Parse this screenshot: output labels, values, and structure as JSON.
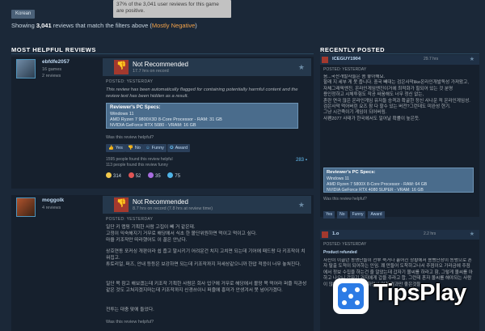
{
  "tooltip": "37% of the 3,041 user reviews for this game are positive.",
  "language_filter": "Korean",
  "summary": {
    "prefix": "Showing",
    "count": "3,041",
    "middle": "reviews that match the filters above (",
    "rating": "Mostly Negative",
    "suffix": ")"
  },
  "sections": {
    "helpful": "MOST HELPFUL REVIEWS",
    "recent": "RECENTLY POSTED"
  },
  "review1": {
    "user": "ebfdfe2057",
    "games": "16 games",
    "reviews": "2 reviews",
    "verdict": "Not Recommended",
    "hours": "17.7 hrs on record",
    "posted": "POSTED: YESTERDAY",
    "body": "This review has been automatically flagged for containing potentially harmful content and the review text has been hidden as a result.",
    "specs_title": "Reviewer's PC Specs:",
    "specs": [
      "Windows 11",
      "AMD Ryzen 7 9800X3D 8-Core Processor - RAM: 31 GB",
      "NVIDIA GeForce RTX 5080 - VRAM: 16 GB"
    ],
    "helpful_q": "Was this review helpful?",
    "btn_yes": "Yes",
    "btn_no": "No",
    "btn_funny": "Funny",
    "btn_award": "Award",
    "found_helpful": "1595 people found this review helpful",
    "found_funny": "113 people found this review funny",
    "comments": "283",
    "awards": [
      "314",
      "52",
      "35",
      "75"
    ]
  },
  "review2": {
    "user": "moggolk",
    "reviews": "4 reviews",
    "verdict": "Not Recommended",
    "hours": "8.7 hrs on record (7.8 hrs at review time)",
    "posted": "POSTED: YESTERDAY",
    "paragraphs": [
      "일단 키 맵핑 기획한 사람 고집이 빼 거 같은데.",
      "고정이 익숙해지기 거무로 해당에서 식초 한 볼단위원하면 먹이고 먹이고 싶다.",
      "마을 키조작만 따라했어도 이 꼴은 안났다.",
      "상호연동 포커싱 개판이라 쉽 줍고 말시키기 어려운건 치지 고치면 되는데 기어에 패드랑 다 키조작이 치워집고.",
      "튜토리얼, 퍼즈, 안내 등등은 보강하면 되는데 키조작까지 저세상같으니까 한압 적응이 너무 놓쳐진다.",
      "일단 목 참고 해보겠는데 키조작 기획한 사람은 회사 업구에 거무로 해당에서 볼망 목 먹어라 퍼즐 직관성 같은 것도 고쳐지겠지마는데 키조작까지 신경쓰이니 퍼즐에 흥미가 안생겨서 못 넘어가겠다.",
      "전투는 대충 맞에 들었다."
    ],
    "helpful_q": "Was this review helpful?"
  },
  "recent1": {
    "user": "ICEGUY1904",
    "hours": "29.7 hrs",
    "posted": "POSTED: YESTERDAY",
    "text": "음...국산개발사들은 좀 좋아해요.\n할래 지 세부 게 못 줍니다. 중국 빼대는 검은사막like온라인개발독성 가져왔고,\n자체그래픽엔진, 온라인게임엔진이거에 최적화가 힐되어 있는 것 분명\n 용인정하고 시체투힘도 작공 싸움해도 너무 정신 없는,\n 혼란 연극 많은 온라인게임 유저들 승격과 확굴한 정신 사나운 적 온라인게임성.\n 검은사막 먹어버린 요즈 참 다 할수 있는 버전?그런데도 미완성 현기.\n그냥 시간죽이기 게임이 되어버림.\n사펜2077 사태가 한국에서도 일어날 확률이 높은듯.",
    "specs_title": "Reviewer's PC Specs:",
    "specs": [
      "Windows 11",
      "AMD Ryzen 7 5800X 8-Core Processor - RAM: 64 GB",
      "NVIDIA GeForce RTX 4080 SUPER - VRAM: 16 GB"
    ],
    "helpful_q": "Was this review helpful?",
    "btns": [
      "Yes",
      "No",
      "Funny",
      "Award"
    ]
  },
  "recent2": {
    "user": "1.o",
    "hours": "2.2 hrs",
    "posted": "POSTED: YESTERDAY",
    "refund": "Product refunded",
    "text": "자신이 이끌던 동맹단들이 전부 죽거나 흩어진 상황에서 용병단장이 동맹으로 혼자 탈출 도적이 되어하는 인임. 꽤 만들어 도착하고나서 주점이오 가라금에 주점에서 정보 수집을 하는건 줄 알았는데 갑자기 몰씨를 하라고 함, 그렇게 몰씨를 아 하고 나오니 갑자기 거지에게 갑을 주라고 합, 그런데 혼자 몰씨를 해야되는 사람이 많다 하고 이로 다시 하면서 연결 결과만 좋은것들..."
  },
  "watermark": "TipsPlay"
}
